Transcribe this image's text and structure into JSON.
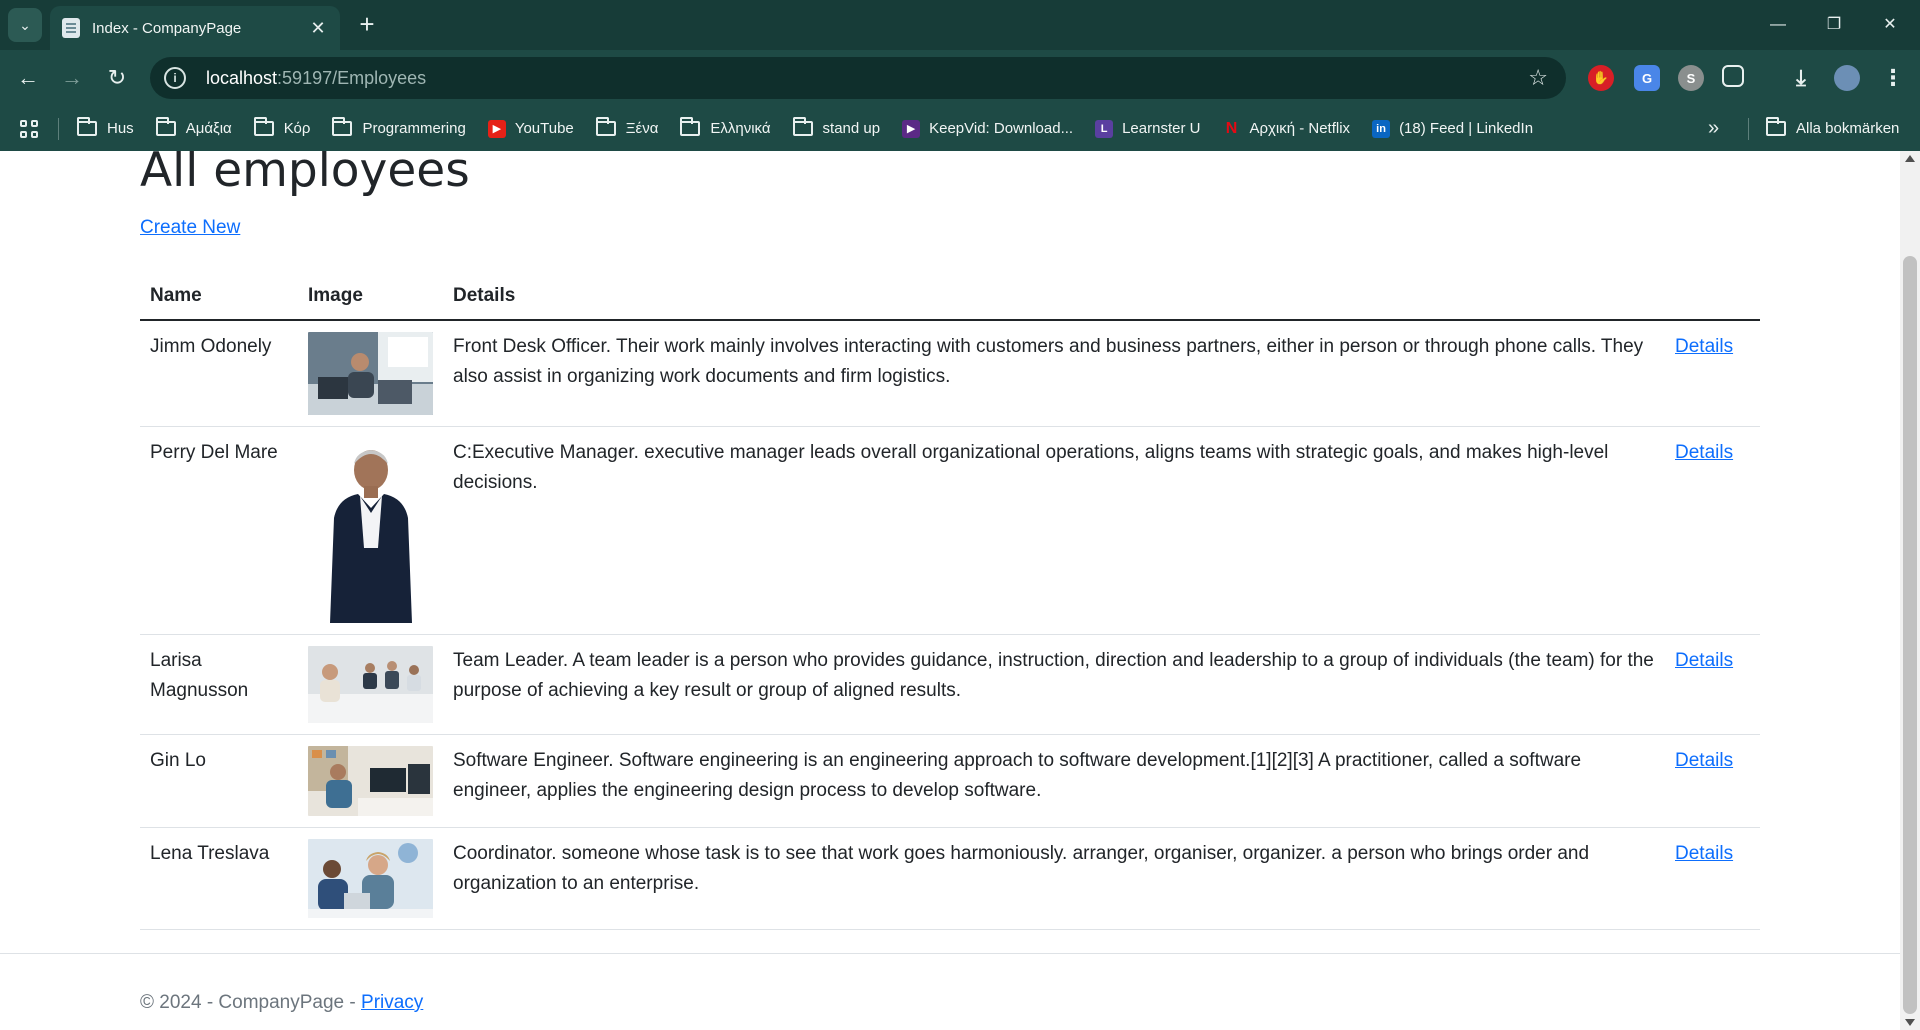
{
  "browser": {
    "tab_title": "Index - CompanyPage",
    "url_host": "localhost",
    "url_rest": ":59197/Employees",
    "bookmarks": [
      {
        "label": "Hus",
        "icon": "folder-icon"
      },
      {
        "label": "Αμάξια",
        "icon": "folder-icon"
      },
      {
        "label": "Κόρ",
        "icon": "folder-icon"
      },
      {
        "label": "Programmering",
        "icon": "folder-icon"
      },
      {
        "label": "YouTube",
        "icon": "youtube-icon"
      },
      {
        "label": "Ξένα",
        "icon": "folder-icon"
      },
      {
        "label": "Ελληνικά",
        "icon": "folder-icon"
      },
      {
        "label": "stand up",
        "icon": "folder-icon"
      },
      {
        "label": "KeepVid: Download...",
        "icon": "keepvid-icon"
      },
      {
        "label": "Learnster U",
        "icon": "learnster-icon"
      },
      {
        "label": "Αρχική - Netflix",
        "icon": "netflix-icon"
      },
      {
        "label": "(18) Feed | LinkedIn",
        "icon": "linkedin-icon"
      }
    ],
    "all_bookmarks": "Alla bokmärken"
  },
  "page": {
    "title": "All employees",
    "create_new": "Create New",
    "columns": {
      "name": "Name",
      "image": "Image",
      "details": "Details"
    },
    "employees": [
      {
        "name": "Jimm Odonely",
        "details": "Front Desk Officer. Their work mainly involves interacting with customers and business partners, either in person or through phone calls. They also assist in organizing work documents and firm logistics.",
        "link": "Details"
      },
      {
        "name": "Perry Del Mare",
        "details": "C:Executive Manager. executive manager leads overall organizational operations, aligns teams with strategic goals, and makes high-level decisions.",
        "link": "Details"
      },
      {
        "name": "Larisa Magnusson",
        "details": "Team Leader. A team leader is a person who provides guidance, instruction, direction and leadership to a group of individuals (the team) for the purpose of achieving a key result or group of aligned results.",
        "link": "Details"
      },
      {
        "name": "Gin Lo",
        "details": "Software Engineer. Software engineering is an engineering approach to software development.[1][2][3] A practitioner, called a software engineer, applies the engineering design process to develop software.",
        "link": "Details"
      },
      {
        "name": "Lena Treslava",
        "details": "Coordinator. someone whose task is to see that work goes harmoniously. arranger, organiser, organizer. a person who brings order and organization to an enterprise.",
        "link": "Details"
      }
    ]
  },
  "footer": {
    "copyright": "© 2024 - CompanyPage - ",
    "privacy": "Privacy"
  }
}
